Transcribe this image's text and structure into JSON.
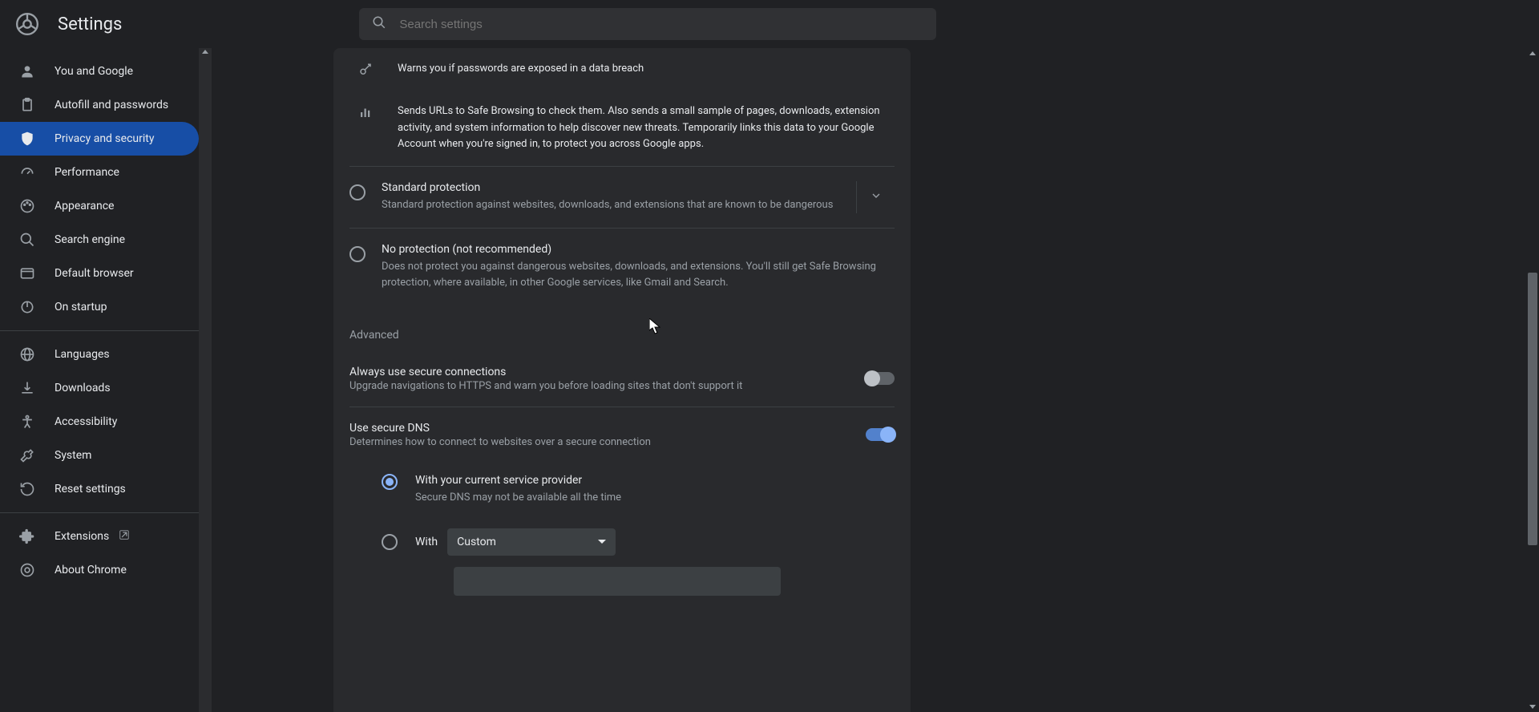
{
  "header": {
    "title": "Settings",
    "search_placeholder": "Search settings"
  },
  "sidebar": {
    "items_top": [
      {
        "label": "You and Google"
      },
      {
        "label": "Autofill and passwords"
      },
      {
        "label": "Privacy and security"
      },
      {
        "label": "Performance"
      },
      {
        "label": "Appearance"
      },
      {
        "label": "Search engine"
      },
      {
        "label": "Default browser"
      },
      {
        "label": "On startup"
      }
    ],
    "items_bottom": [
      {
        "label": "Languages"
      },
      {
        "label": "Downloads"
      },
      {
        "label": "Accessibility"
      },
      {
        "label": "System"
      },
      {
        "label": "Reset settings"
      }
    ],
    "extensions_label": "Extensions",
    "about_label": "About Chrome"
  },
  "main": {
    "warn_row": "Warns you if passwords are exposed in a data breach",
    "urls_row": "Sends URLs to Safe Browsing to check them. Also sends a small sample of pages, downloads, extension activity, and system information to help discover new threats. Temporarily links this data to your Google Account when you're signed in, to protect you across Google apps.",
    "std_title": "Standard protection",
    "std_desc": "Standard protection against websites, downloads, and extensions that are known to be dangerous",
    "no_title": "No protection (not recommended)",
    "no_desc": "Does not protect you against dangerous websites, downloads, and extensions. You'll still get Safe Browsing protection, where available, in other Google services, like Gmail and Search.",
    "advanced": "Advanced",
    "https_title": "Always use secure connections",
    "https_desc": "Upgrade navigations to HTTPS and warn you before loading sites that don't support it",
    "dns_title": "Use secure DNS",
    "dns_desc": "Determines how to connect to websites over a secure connection",
    "dns_provider_title": "With your current service provider",
    "dns_provider_desc": "Secure DNS may not be available all the time",
    "dns_with_label": "With",
    "dns_custom_label": "Custom"
  }
}
